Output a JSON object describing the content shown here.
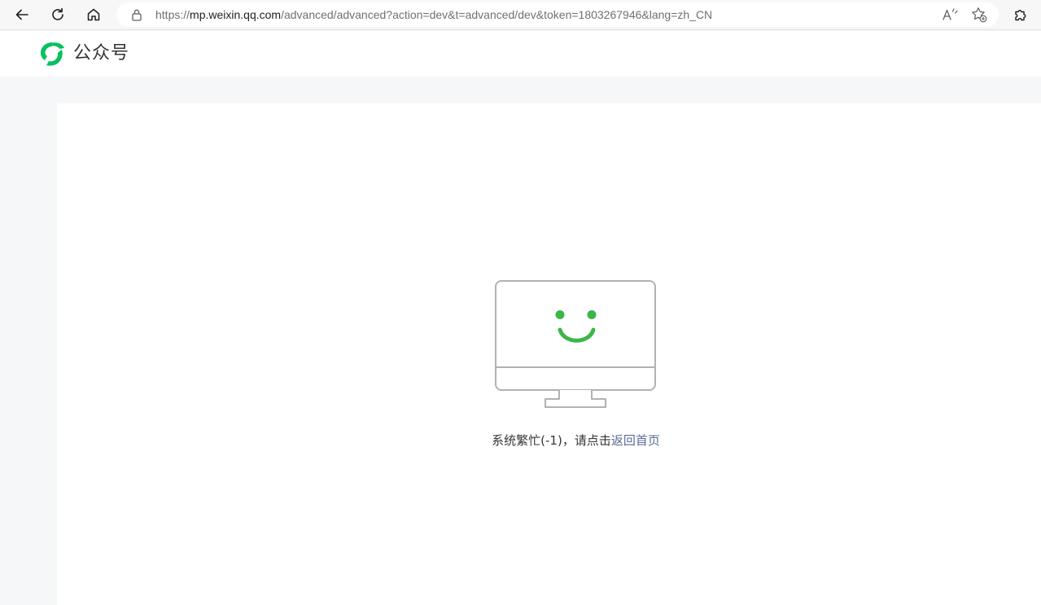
{
  "browser": {
    "url": {
      "scheme": "https://",
      "host": "mp.weixin.qq.com",
      "path": "/advanced/advanced?action=dev&t=advanced/dev&token=1803267946&lang=zh_CN"
    },
    "icons": {
      "back": "arrow-left-icon",
      "refresh": "refresh-icon",
      "home": "home-icon",
      "lock": "lock-icon",
      "read_aloud": "read-aloud-icon",
      "favorite": "add-favorite-icon",
      "extensions": "extensions-icon"
    }
  },
  "header": {
    "logo_text": "公众号",
    "brand_color": "#07c160"
  },
  "error": {
    "message": "系统繁忙(-1)，请点击",
    "link_label": "返回首页",
    "link_color": "#576b95",
    "illustration": "monitor-smiley-icon",
    "accent_color": "#3cb649"
  }
}
